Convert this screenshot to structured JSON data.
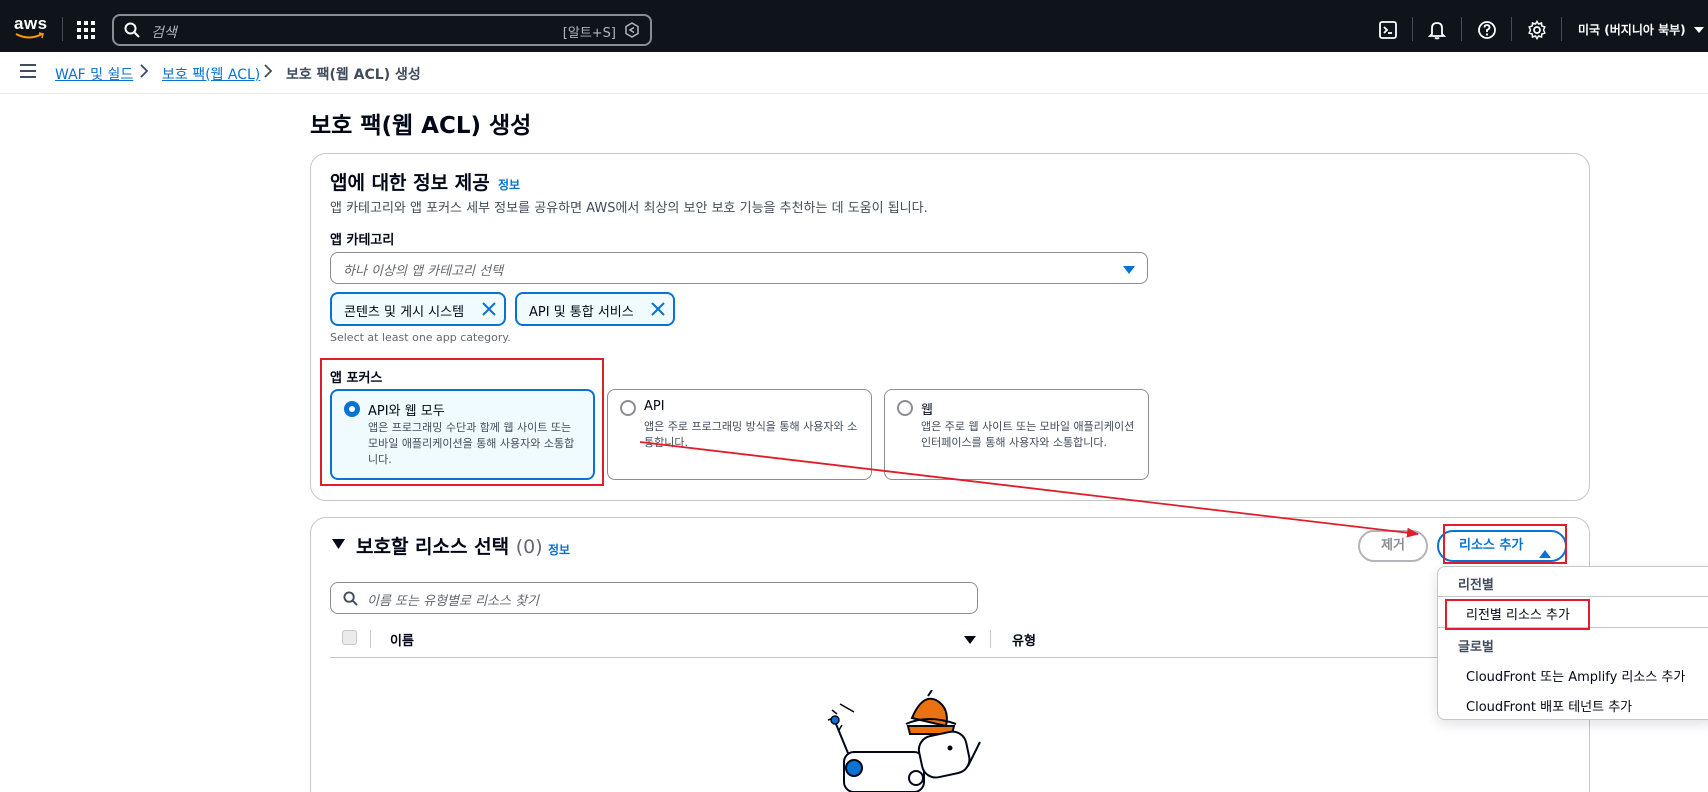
{
  "topnav": {
    "logo_text": "aws",
    "search_placeholder": "검색",
    "search_shortcut": "[알트+S]",
    "region_label": "미국 (버지니아 북부)"
  },
  "breadcrumb": {
    "items": [
      "WAF 및 쉴드",
      "보호 팩(웹 ACL)"
    ],
    "current": "보호 팩(웹 ACL) 생성"
  },
  "page": {
    "title": "보호 팩(웹 ACL) 생성"
  },
  "app_info": {
    "heading": "앱에 대한 정보 제공",
    "info_link": "정보",
    "description": "앱 카테고리와 앱 포커스 세부 정보를 공유하면 AWS에서 최상의 보안 보호 기능을 추천하는 데 도움이 됩니다.",
    "category_label": "앱 카테고리",
    "category_placeholder": "하나 이상의 앱 카테고리 선택",
    "tokens": [
      "콘텐츠 및 게시 시스템",
      "API 및 통합 서비스"
    ],
    "category_hint": "Select at least one app category.",
    "focus_label": "앱 포커스",
    "focus_options": [
      {
        "title": "API와 웹 모두",
        "desc": "앱은 프로그래밍 수단과 함께 웹 사이트 또는 모바일 애플리케이션을 통해 사용자와 소통합니다.",
        "selected": true
      },
      {
        "title": "API",
        "desc": "앱은 주로 프로그래밍 방식을 통해 사용자와 소통합니다.",
        "selected": false
      },
      {
        "title": "웹",
        "desc": "앱은 주로 웹 사이트 또는 모바일 애플리케이션 인터페이스를 통해 사용자와 소통합니다.",
        "selected": false
      }
    ]
  },
  "resources": {
    "heading": "보호할 리소스 선택",
    "count": "(0)",
    "info_link": "정보",
    "remove_label": "제거",
    "add_label": "리소스 추가",
    "search_placeholder": "이름 또는 유형별로 리소스 찾기",
    "columns": [
      "이름",
      "유형"
    ]
  },
  "dropdown": {
    "group_regional": "리전별",
    "item_regional": "리전별 리소스 추가",
    "group_global": "글로벌",
    "item_cloudfront": "CloudFront 또는 Amplify 리소스 추가",
    "item_tenant": "CloudFront 배포 테넌트 추가"
  },
  "colors": {
    "nav_bg": "#0f141a",
    "link": "#0972d3",
    "annotation": "#e01e2b",
    "mascot_hat": "#ec7211"
  }
}
